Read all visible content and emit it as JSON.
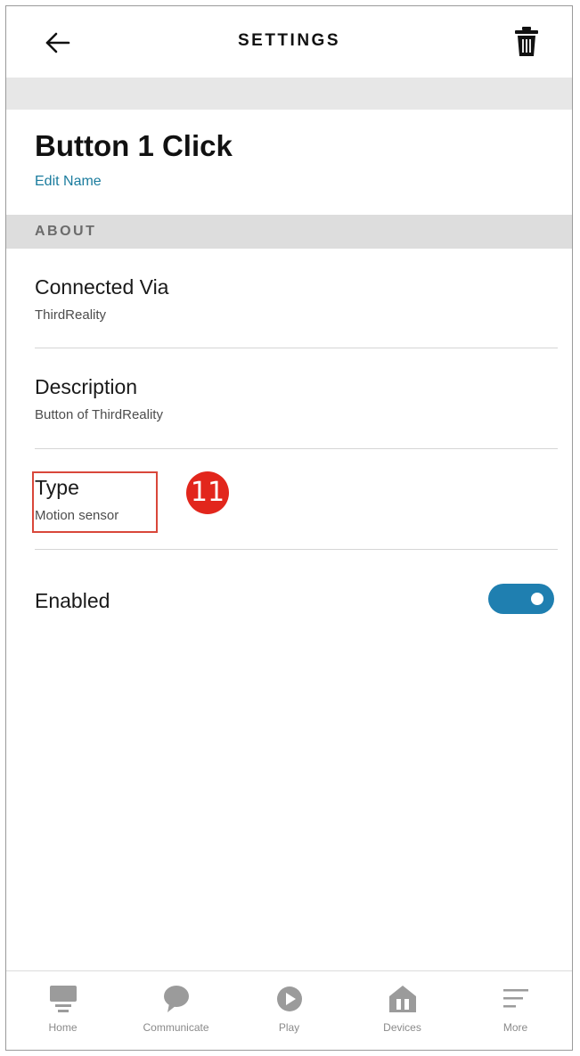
{
  "header": {
    "title": "SETTINGS",
    "back_icon": "arrow-left-icon",
    "delete_icon": "trash-icon"
  },
  "device": {
    "name": "Button 1 Click",
    "edit_label": "Edit Name"
  },
  "about": {
    "section_label": "ABOUT",
    "rows": [
      {
        "title": "Connected Via",
        "value": "ThirdReality"
      },
      {
        "title": "Description",
        "value": "Button of ThirdReality"
      },
      {
        "title": "Type",
        "value": "Motion sensor"
      }
    ],
    "enabled": {
      "label": "Enabled",
      "value": true
    }
  },
  "annotation": {
    "step_number": "11",
    "badge_color": "#e2261c",
    "box_color": "#d9473a"
  },
  "colors": {
    "accent": "#1f7fb0",
    "link": "#1b7c9e",
    "icon_gray": "#8a8a8a"
  },
  "bottom_nav": {
    "items": [
      {
        "label": "Home",
        "icon": "home-icon"
      },
      {
        "label": "Communicate",
        "icon": "chat-bubble-icon"
      },
      {
        "label": "Play",
        "icon": "play-icon"
      },
      {
        "label": "Devices",
        "icon": "devices-icon"
      },
      {
        "label": "More",
        "icon": "menu-lines-icon"
      }
    ]
  }
}
